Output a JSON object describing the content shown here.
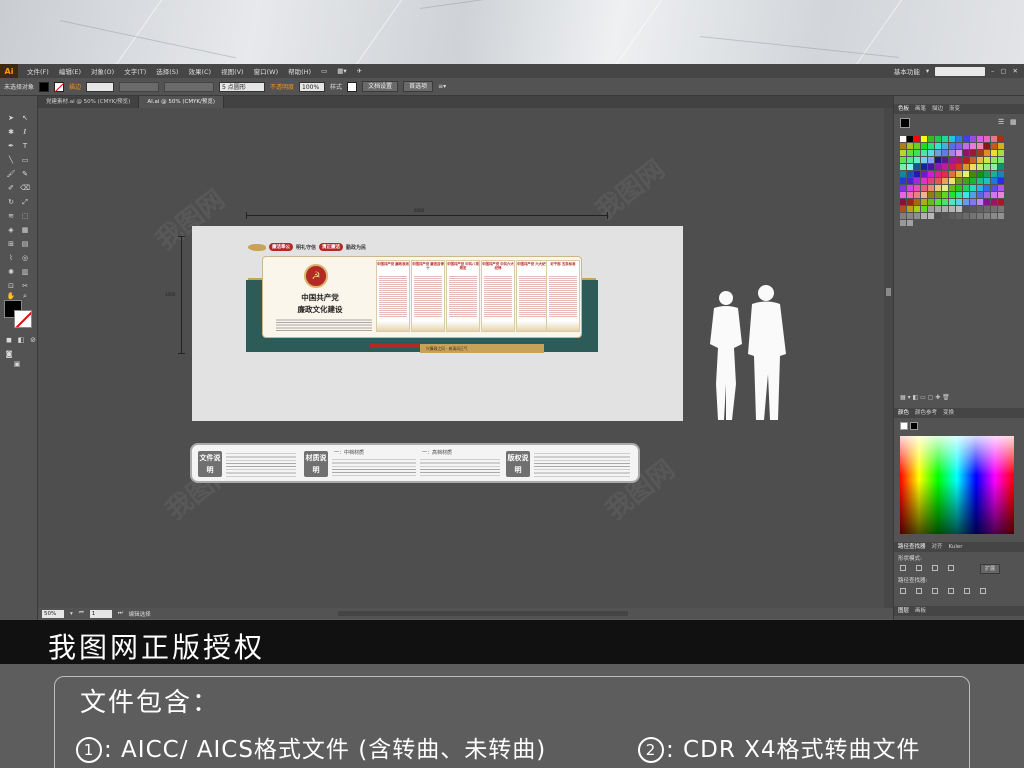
{
  "app": {
    "logo": "Ai",
    "workspace": "基本功能"
  },
  "menu": [
    "文件(F)",
    "编辑(E)",
    "对象(O)",
    "文字(T)",
    "选择(S)",
    "效果(C)",
    "视图(V)",
    "窗口(W)",
    "帮助(H)"
  ],
  "control_bar": {
    "selection": "未选择对象",
    "stroke_label": "描边",
    "brush_value": "5 点圆形",
    "opacity_label": "不透明度",
    "opacity_value": "100%",
    "style_label": "样式",
    "doc_setup": "文档设置",
    "preferences": "首选项"
  },
  "tabs": [
    "党建素材.ai @ 50% (CMYK/预览)",
    "AI.ai @ 50% (CMYK/预览)"
  ],
  "status": {
    "zoom": "50%",
    "page": "1",
    "tool": "编辑选择"
  },
  "right_panel": {
    "swatch_tabs": [
      "色板",
      "画笔",
      "描边",
      "渐变"
    ],
    "color_tabs": [
      "颜色",
      "颜色参考",
      "变换"
    ],
    "pathfinder_tabs": [
      "路径查找器",
      "对齐",
      "Kuler"
    ],
    "shape_modes": "形状模式:",
    "expand": "扩展",
    "pathfinders": "路径查找器:",
    "layer_tabs": [
      "图层",
      "画板"
    ]
  },
  "artboard": {
    "dim_width": "6000",
    "dim_height": "1000",
    "slogan_pill1": "廉洁奉公",
    "slogan_text1": "明礼守信",
    "slogan_pill2": "清正廉洁",
    "slogan_text2": "勤政为民",
    "emblem": "☭",
    "title_line1": "中国共产党",
    "title_line2": "廉政文化建设",
    "columns": [
      "中国共产党 廉政准则",
      "中国共产党 廉洁自律十",
      "中国共产党 中共八项规定",
      "中国共产党 中共六大纪律",
      "中国共产党 六大纪律",
      "好干部 五条标准"
    ],
    "bottom_caption": "兴廉政之风 · 树清风正气"
  },
  "info_panel": {
    "tags": [
      "文件说明",
      "材质说明",
      "版权说明"
    ],
    "heading1": "一：中档材质",
    "heading2": "一：高档材质"
  },
  "promo": {
    "banner": "我图网正版授权",
    "heading": "文件包含：",
    "item1_num": "1",
    "item1": ": AICC/ AICS格式文件 (含转曲、未转曲)",
    "item2_num": "2",
    "item2": ": CDR X4格式转曲文件"
  },
  "watermark": "我图网",
  "colors": {
    "party_red": "#b32a25",
    "wall_green": "#2d5c58",
    "gold": "#c9a25a"
  }
}
